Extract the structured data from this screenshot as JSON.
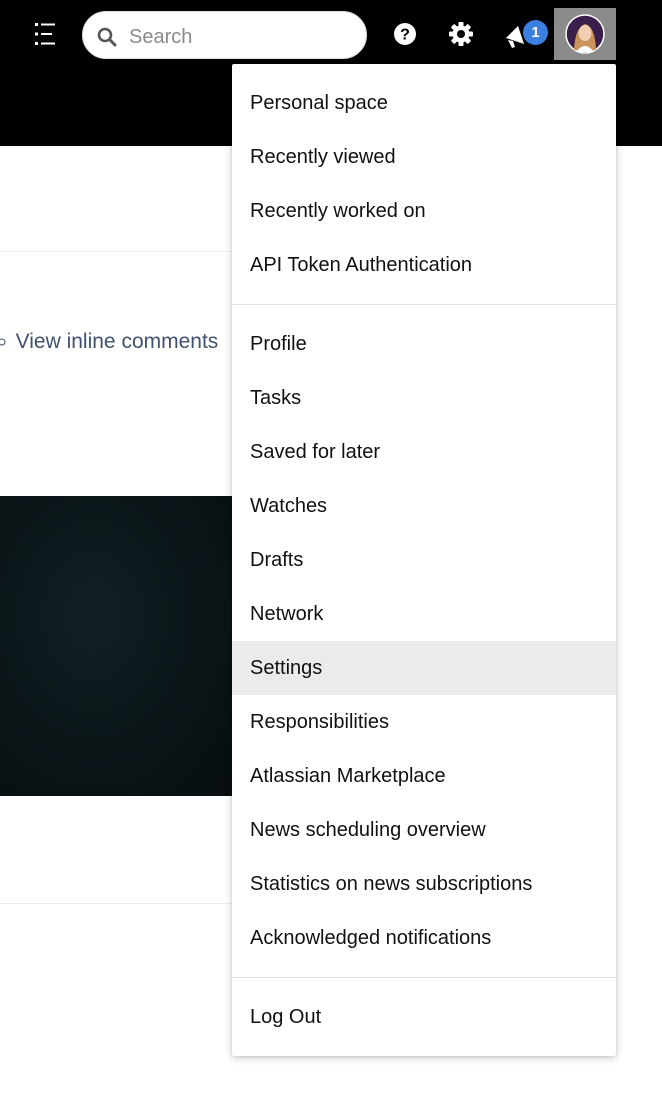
{
  "header": {
    "search_placeholder": "Search",
    "notification_count": "1",
    "icons": {
      "menu": "menu-list-icon",
      "search": "search-icon",
      "help": "help-icon",
      "settings": "gear-icon",
      "notifications": "megaphone-icon",
      "avatar": "user-avatar"
    }
  },
  "page": {
    "inline_comments_link": "View inline comments"
  },
  "user_menu": {
    "section1": [
      {
        "label": "Personal space"
      },
      {
        "label": "Recently viewed"
      },
      {
        "label": "Recently worked on"
      },
      {
        "label": "API Token Authentication"
      }
    ],
    "section2": [
      {
        "label": "Profile"
      },
      {
        "label": "Tasks"
      },
      {
        "label": "Saved for later"
      },
      {
        "label": "Watches"
      },
      {
        "label": "Drafts"
      },
      {
        "label": "Network"
      },
      {
        "label": "Settings",
        "highlighted": true
      },
      {
        "label": "Responsibilities"
      },
      {
        "label": "Atlassian Marketplace"
      },
      {
        "label": "News scheduling overview"
      },
      {
        "label": "Statistics on news subscriptions"
      },
      {
        "label": "Acknowledged notifications"
      }
    ],
    "section3": [
      {
        "label": "Log Out"
      }
    ]
  },
  "colors": {
    "header_bg": "#000000",
    "badge_bg": "#3b7fe0",
    "link": "#42526e",
    "highlight_bg": "#ebebeb"
  }
}
